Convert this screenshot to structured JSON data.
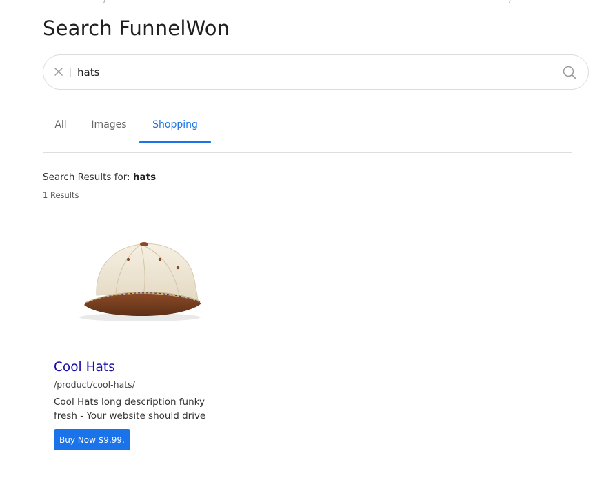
{
  "page": {
    "title": "Search FunnelWon"
  },
  "search": {
    "query": "hats",
    "placeholder": ""
  },
  "icons": {
    "clear": "close-icon",
    "search": "search-icon"
  },
  "tabs": [
    {
      "label": "All",
      "active": false
    },
    {
      "label": "Images",
      "active": false
    },
    {
      "label": "Shopping",
      "active": true
    }
  ],
  "results": {
    "label": "Search Results for:",
    "query": "hats",
    "count_text": "1 Results"
  },
  "items": [
    {
      "title": "Cool Hats",
      "url": "/product/cool-hats/",
      "description": "Cool Hats long description funky fresh - Your website should drive",
      "button_label": "Buy Now $9.99."
    }
  ],
  "colors": {
    "accent": "#1a73e8",
    "link": "#1a0dab"
  }
}
